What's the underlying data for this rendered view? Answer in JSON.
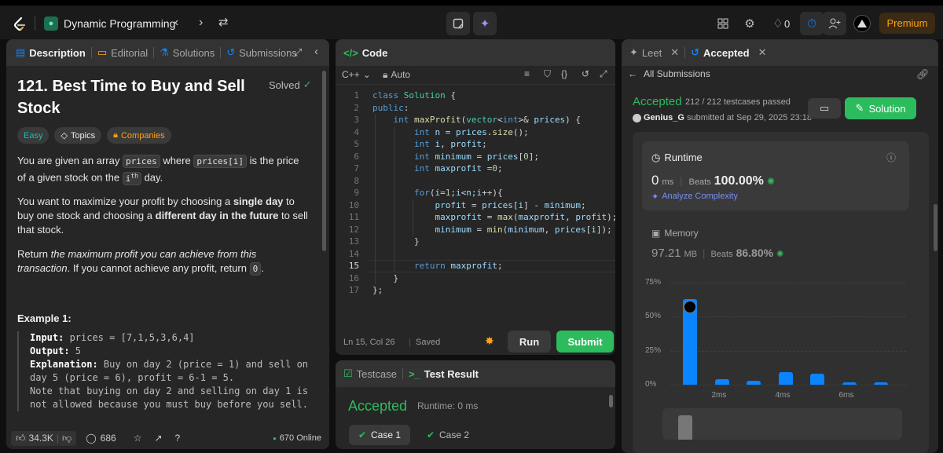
{
  "topbar": {
    "list_name": "Dynamic Programming",
    "streak_count": "0",
    "premium_label": "Premium"
  },
  "left": {
    "tabs": [
      "Description",
      "Editorial",
      "Solutions",
      "Submissions"
    ],
    "title": "121. Best Time to Buy and Sell Stock",
    "solved_label": "Solved",
    "tags": [
      "Easy",
      "Topics",
      "Companies"
    ],
    "p1": {
      "a": "You are given an array ",
      "c1": "prices",
      "b": " where ",
      "c2": "prices[i]",
      "c": " is the price of a given stock on the ",
      "c3": "i",
      "sup": "th",
      "d": " day."
    },
    "p2": {
      "a": "You want to maximize your profit by choosing a ",
      "b": "single day",
      "c": " to buy one stock and choosing a ",
      "d": "different day in the future",
      "e": " to sell that stock."
    },
    "p3": {
      "a": "Return ",
      "b": "the maximum profit you can achieve from this transaction",
      "c": ". If you cannot achieve any profit, return ",
      "code": "0",
      "d": "."
    },
    "example_title": "Example 1:",
    "example": {
      "input_label": "Input:",
      "input": " prices = [7,1,5,3,6,4]",
      "output_label": "Output:",
      "output": " 5",
      "expl_label": "Explanation:",
      "expl": " Buy on day 2 (price = 1) and sell on day 5 (price = 6), profit = 6-1 = 5.",
      "note": "Note that buying on day 2 and selling on day 1 is not allowed because you must buy before you sell."
    },
    "footer": {
      "likes": "34.3K",
      "comments": "686",
      "online": "670 Online"
    }
  },
  "code": {
    "header": "Code",
    "language": "C++",
    "auto": "Auto",
    "status_pos": "Ln 15, Col 26",
    "status_saved": "Saved",
    "run_label": "Run",
    "submit_label": "Submit"
  },
  "testpanel": {
    "tabs": [
      "Testcase",
      "Test Result"
    ],
    "accepted": "Accepted",
    "runtime": "Runtime: 0 ms",
    "cases": [
      "Case 1",
      "Case 2"
    ]
  },
  "right": {
    "tabs": [
      "Leet",
      "Accepted"
    ],
    "all_submissions": "All Submissions",
    "accepted": "Accepted",
    "testcases": "212 / 212 testcases passed",
    "user": "Genius_G",
    "submitted": " submitted at Sep 29, 2025 23:18",
    "solution_label": "Solution",
    "runtime": {
      "label": "Runtime",
      "value": "0",
      "unit": "ms",
      "beats_label": "Beats",
      "beats": "100.00%",
      "analyze": "Analyze Complexity"
    },
    "memory": {
      "label": "Memory",
      "value": "97.21",
      "unit": "MB",
      "beats_label": "Beats",
      "beats": "86.80%"
    }
  },
  "chart_data": {
    "type": "bar",
    "y_ticks": [
      "75%",
      "50%",
      "25%",
      "0%"
    ],
    "x_ticks": [
      "2ms",
      "4ms",
      "6ms"
    ],
    "ylim": [
      0,
      75
    ],
    "values": [
      63,
      4,
      3,
      9,
      8,
      2,
      2
    ],
    "bar_color": "#0a84ff"
  },
  "colors": {
    "accent_green": "#2cbb5d",
    "orange": "#ffa116",
    "blue": "#0a84ff"
  }
}
